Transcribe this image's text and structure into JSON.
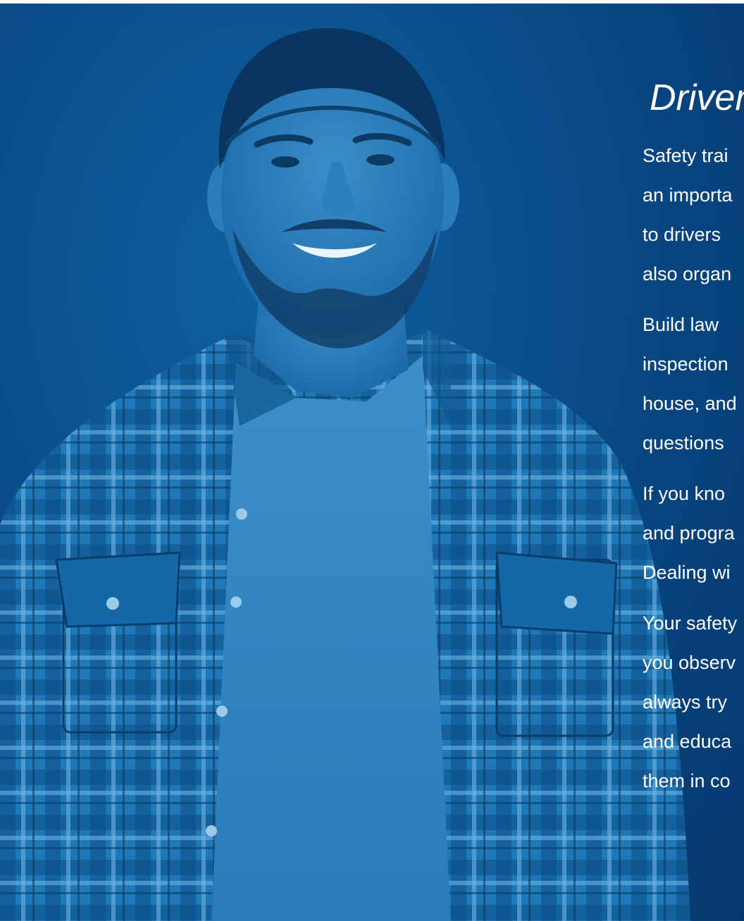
{
  "hero": {
    "image_alt": "Smiling man wearing a baseball cap and plaid flannel shirt over a grey t-shirt, blue duotone",
    "heading": "Driver",
    "paragraphs": [
      {
        "lines": [
          "Safety trai",
          "an importa",
          "to drivers",
          "also organ"
        ]
      },
      {
        "lines": [
          "Build law",
          "inspection",
          "house, and",
          "questions"
        ]
      },
      {
        "lines": [
          "If you kno",
          "and progra",
          "Dealing wi"
        ]
      },
      {
        "lines": [
          "Your safety",
          "you observ",
          "always try",
          "and educa",
          "them in co"
        ]
      }
    ]
  },
  "colors": {
    "background": "#0a4f8c",
    "overlay": "#0b5596",
    "text": "#ffffff"
  }
}
